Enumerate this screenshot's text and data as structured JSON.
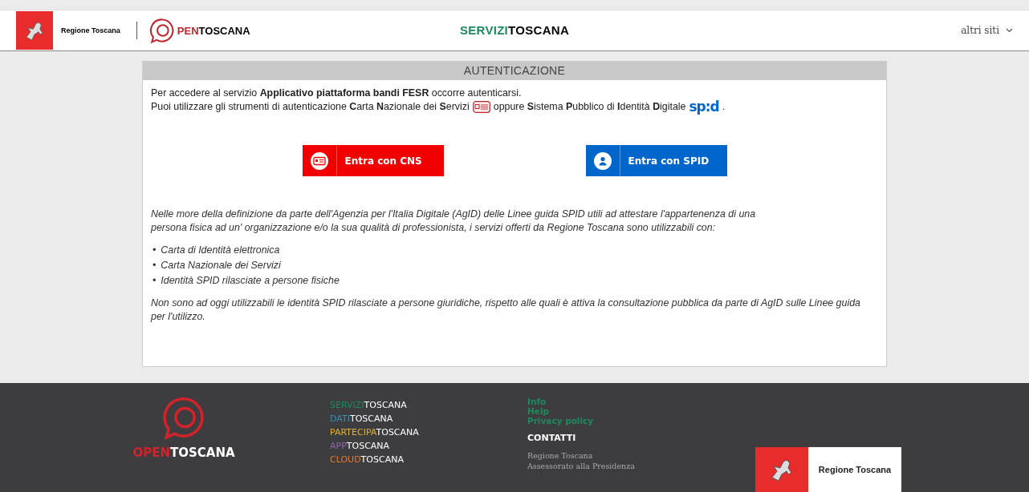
{
  "header": {
    "org_name": "Regione Toscana",
    "brand": {
      "prefix": "PEN",
      "suffix": "TOSCANA"
    },
    "site": {
      "prefix": "SERVIZI",
      "suffix": "TOSCANA"
    },
    "menu": "altri siti"
  },
  "card": {
    "title": "AUTENTICAZIONE",
    "intro": "Per accedere al servizio **Applicativo piattaforma bandi FESR** occorre autenticarsi.",
    "tools_before": "Puoi utilizzare gli strumenti di autenticazione **C**arta **N**azionale dei **S**ervizi",
    "tools_after": "oppure **S**istema **P**ubblico di **I**dentità **D**igitale",
    "spid_mark": "sp:d",
    "tools_end": ".",
    "buttons": [
      {
        "kind": "cns",
        "label": "Entra con CNS",
        "color": "#f00000"
      },
      {
        "kind": "spid",
        "label": "Entra con SPID",
        "color": "#0066cc"
      }
    ],
    "note": "Nelle more della definizione da parte dell'Agenzia per l'Italia Digitale (AgID) delle Linee guida SPID utili ad attestare l'appartenenza di una persona fisica ad un' organizzazione e/o la sua qualità di professionista, i servizi offerti da Regione Toscana sono utilizzabili con:",
    "list": [
      {
        "bullet": "•",
        "text": "Carta di Identità elettronica"
      },
      {
        "bullet": "•",
        "text": "Carta Nazionale dei Servizi"
      },
      {
        "bullet": "•",
        "text": "Identità SPID rilasciate a persone fisiche"
      }
    ],
    "closing": "Non sono ad oggi utilizzabili le identità SPID rilasciate a persone giuridiche, rispetto alle quali è attiva la consultazione pubblica da parte di AgID sulle Linee guida per l'utilizzo."
  },
  "footer": {
    "logo": {
      "prefix": "OPEN",
      "suffix": "TOSCANA"
    },
    "sites": [
      {
        "prefix": "SERVIZI",
        "suffix": "TOSCANA",
        "color": "#1f8a5f"
      },
      {
        "prefix": "DATI",
        "suffix": "TOSCANA",
        "color": "#3d8fb0"
      },
      {
        "prefix": "PARTECIPA",
        "suffix": "TOSCANA",
        "color": "#e0b234"
      },
      {
        "prefix": "APP",
        "suffix": "TOSCANA",
        "color": "#8a67a8"
      },
      {
        "prefix": "CLOUD",
        "suffix": "TOSCANA",
        "color": "#e07a3a"
      }
    ],
    "links": [
      "Info",
      "Help",
      "Privacy policy"
    ],
    "contacts_title": "CONTATTI",
    "contacts": [
      "Regione Toscana",
      "Assessorato alla Presidenza"
    ],
    "org_name": "Regione Toscana"
  }
}
